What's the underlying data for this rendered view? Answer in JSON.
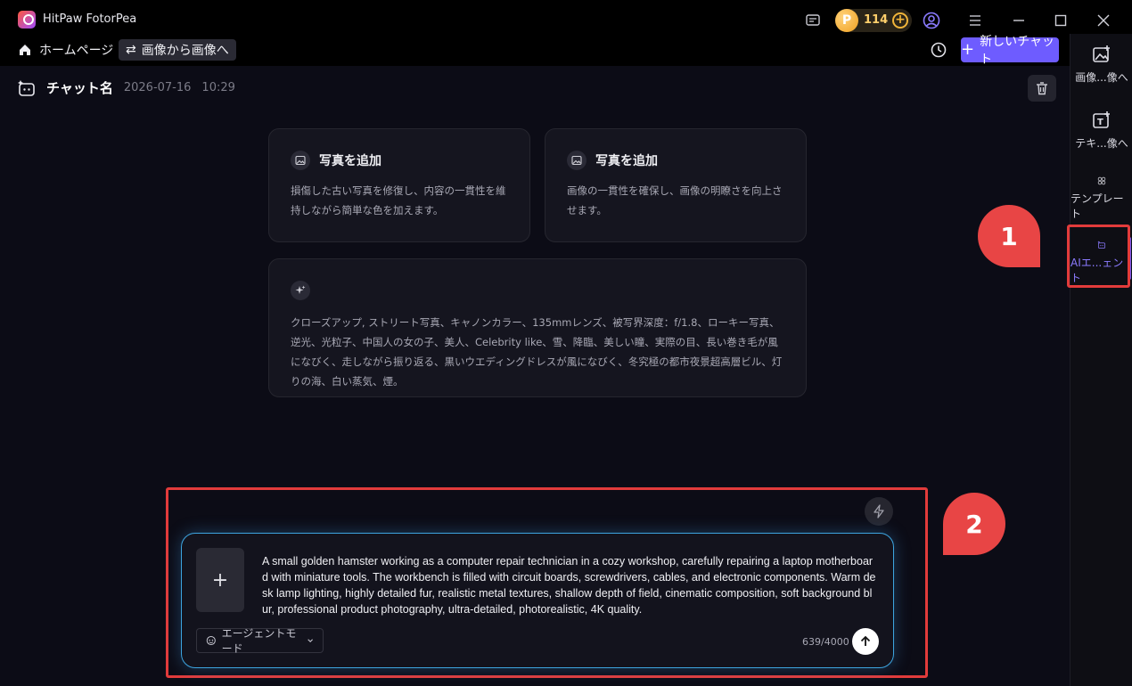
{
  "app": {
    "title": "HitPaw FotorPea",
    "credits": "114",
    "coin_symbol": "P"
  },
  "nav": {
    "home_label": "ホームページ",
    "convert_label": "画像から画像へ",
    "new_chat_label": "新しいチャット"
  },
  "sidebar": {
    "items": [
      {
        "label": "画像...像へ",
        "icon": "image-add-icon"
      },
      {
        "label": "テキ...像へ",
        "icon": "text-to-image-icon"
      },
      {
        "label": "テンプレート",
        "icon": "template-icon"
      },
      {
        "label": "AIエ...ェント",
        "icon": "ai-agent-icon",
        "active": true
      }
    ]
  },
  "chat": {
    "name": "チャット名",
    "date": "2026-07-16",
    "time": "10:29"
  },
  "cards": [
    {
      "title": "写真を追加",
      "desc": "損傷した古い写真を修復し、内容の一貫性を維持しながら簡単な色を加えます。"
    },
    {
      "title": "写真を追加",
      "desc": "画像の一貫性を確保し、画像の明瞭さを向上させます。"
    },
    {
      "title": "",
      "desc": "クローズアップ, ストリート写真、キャノンカラー、135mmレンズ、被写界深度：f/1.8、ローキー写真、逆光、光粒子、中国人の女の子、美人、Celebrity like、雪、降臨、美しい瞳、実際の目、長い巻き毛が風になびく、走しながら振り返る、黒いウエディングドレスが風になびく、冬究極の都市夜景超高層ビル、灯りの海、白い蒸気、煙。"
    }
  ],
  "input": {
    "prompt": "A small golden hamster working as a computer repair technician in a cozy workshop, carefully repairing a laptop motherboard with miniature tools. The workbench is filled with circuit boards, screwdrivers, cables, and electronic components. Warm desk lamp lighting, highly detailed fur, realistic metal textures, shallow depth of field, cinematic composition, soft background blur, professional product photography, ultra-detailed, photorealistic, 4K quality.",
    "mode_label": "エージェントモード",
    "char_count": "639/4000"
  },
  "annotations": {
    "callout_1": "1",
    "callout_2": "2"
  },
  "colors": {
    "accent": "#6e5cff",
    "highlight": "#e23b3b",
    "input_glow": "#3da5e0"
  }
}
